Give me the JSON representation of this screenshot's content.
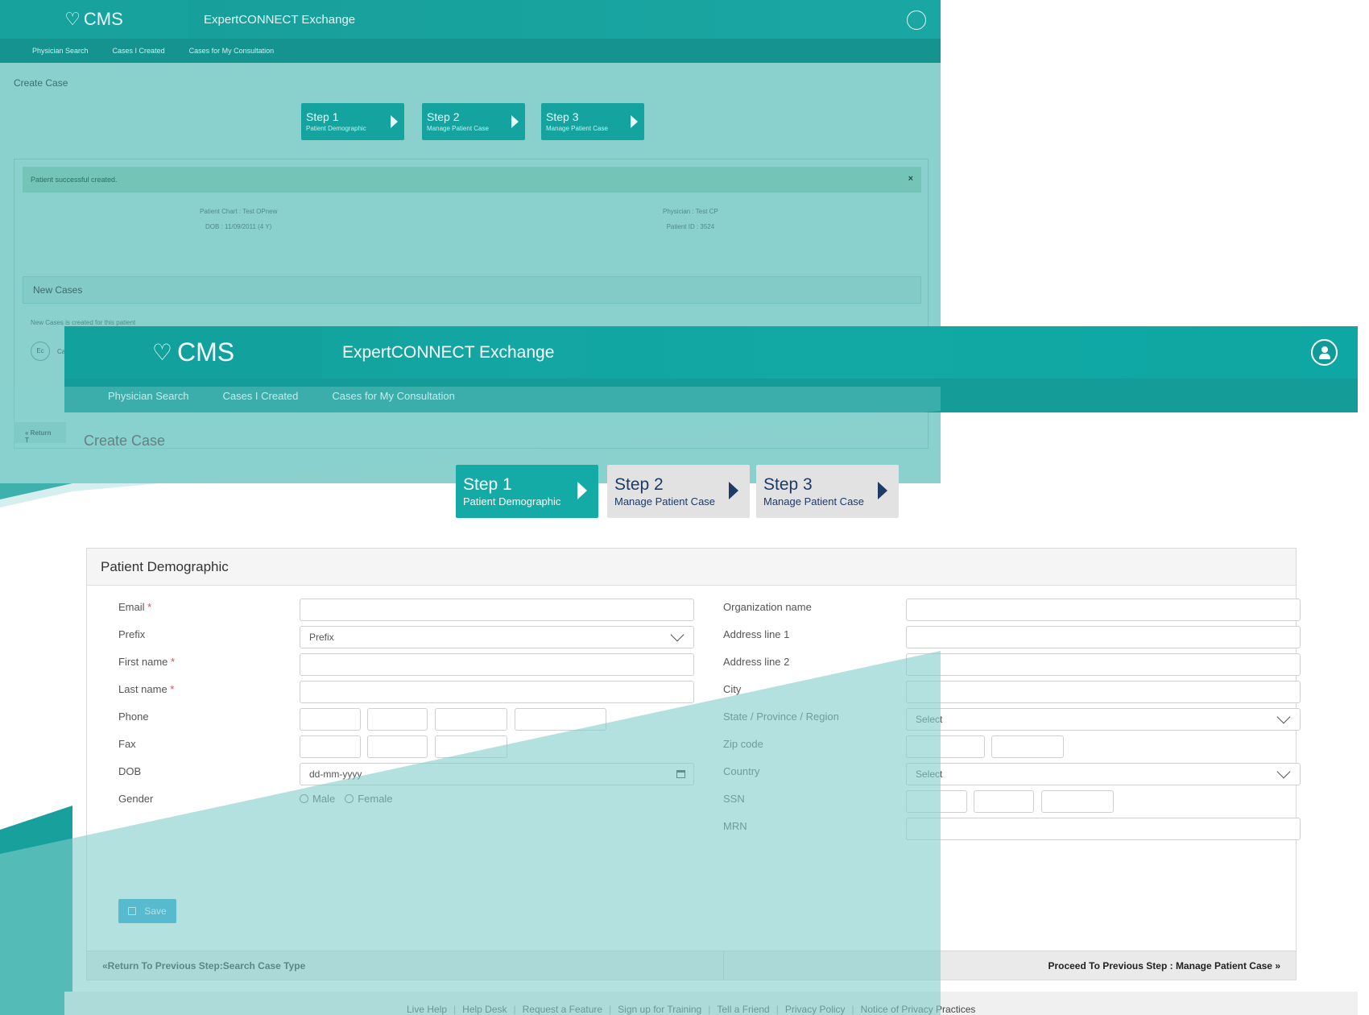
{
  "back": {
    "logo": "CMS",
    "app_title": "ExpertCONNECT Exchange",
    "nav": [
      "Physician Search",
      "Cases I Created",
      "Cases for My Consultation"
    ],
    "breadcrumb": "Create Case",
    "steps": [
      {
        "title": "Step 1",
        "subtitle": "Patient Demographic"
      },
      {
        "title": "Step 2",
        "subtitle": "Manage Patient Case"
      },
      {
        "title": "Step 3",
        "subtitle": "Manage Patient Case"
      }
    ],
    "alert": "Patient successful created.",
    "alert_close": "×",
    "patient_chart": "Patient Chart : Test OPnew",
    "dob": "DOB : 11/09/2011 (4 Y)",
    "physician": "Physician : Test CP",
    "patient_id": "Patient ID : 3524",
    "new_cases_title": "New Cases",
    "new_cases_note": "New Cases is created for this patient",
    "avatar_initials": "Ec",
    "avatar_label": "Ca",
    "return_label": "« Return T"
  },
  "front": {
    "logo": "CMS",
    "app_title": "ExpertCONNECT Exchange",
    "nav": [
      "Physician Search",
      "Cases I Created",
      "Cases for My Consultation"
    ],
    "breadcrumb": "Create Case",
    "steps": [
      {
        "title": "Step 1",
        "subtitle": "Patient Demographic",
        "active": true
      },
      {
        "title": "Step 2",
        "subtitle": "Manage Patient Case",
        "active": false
      },
      {
        "title": "Step 3",
        "subtitle": "Manage Patient Case",
        "active": false
      }
    ],
    "panel_title": "Patient Demographic",
    "left_fields": {
      "email": "Email",
      "prefix": "Prefix",
      "prefix_value": "Prefix",
      "first_name": "First name",
      "last_name": "Last name",
      "phone": "Phone",
      "fax": "Fax",
      "dob": "DOB",
      "dob_placeholder": "dd-mm-yyyy",
      "gender": "Gender",
      "gender_options": [
        "Male",
        "Female"
      ],
      "required_mark": "*"
    },
    "right_fields": {
      "organization": "Organization name",
      "address1": "Address line 1",
      "address2": "Address line 2",
      "city": "City",
      "state": "State / Province / Region",
      "state_value": "Select",
      "zip": "Zip code",
      "country": "Country",
      "country_value": "Select",
      "ssn": "SSN",
      "mrn": "MRN"
    },
    "save_label": "Save",
    "prev_step": "«Return To Previous Step:Search Case Type",
    "next_step": "Proceed To Previous Step : Manage Patient Case »",
    "footer_links": [
      "Live Help",
      "Help Desk",
      "Request a Feature",
      "Sign up for Training",
      "Tell a Friend",
      "Privacy Policy",
      "Notice of Privacy Practices"
    ]
  },
  "colors": {
    "teal": "#14a29e",
    "teal_light": "#8ad1ce",
    "navy": "#1e3a66",
    "save_blue": "#1f9fd8",
    "required_red": "#d9534f"
  }
}
